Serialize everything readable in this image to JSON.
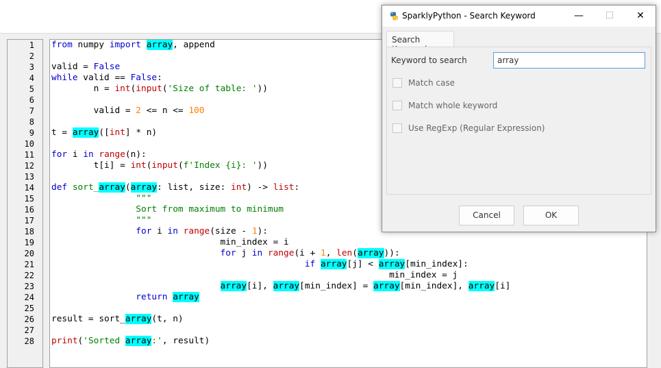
{
  "editor": {
    "line_numbers": [
      "1",
      "2",
      "3",
      "4",
      "5",
      "6",
      "7",
      "8",
      "9",
      "10",
      "11",
      "12",
      "13",
      "14",
      "15",
      "16",
      "17",
      "18",
      "19",
      "20",
      "21",
      "22",
      "23",
      "24",
      "25",
      "26",
      "27",
      "28"
    ]
  },
  "dialog": {
    "title": "SparklyPython - Search Keyword",
    "minimize": "—",
    "maximize": "☐",
    "close": "✕",
    "tab_label": "Search Keyword",
    "keyword_label": "Keyword to search",
    "keyword_value": "array",
    "match_case_label": "Match case",
    "match_case_checked": false,
    "whole_keyword_label": "Match whole keyword",
    "whole_keyword_checked": false,
    "regexp_label": "Use RegExp (Regular Expression)",
    "regexp_checked": false,
    "cancel_label": "Cancel",
    "ok_label": "OK"
  }
}
